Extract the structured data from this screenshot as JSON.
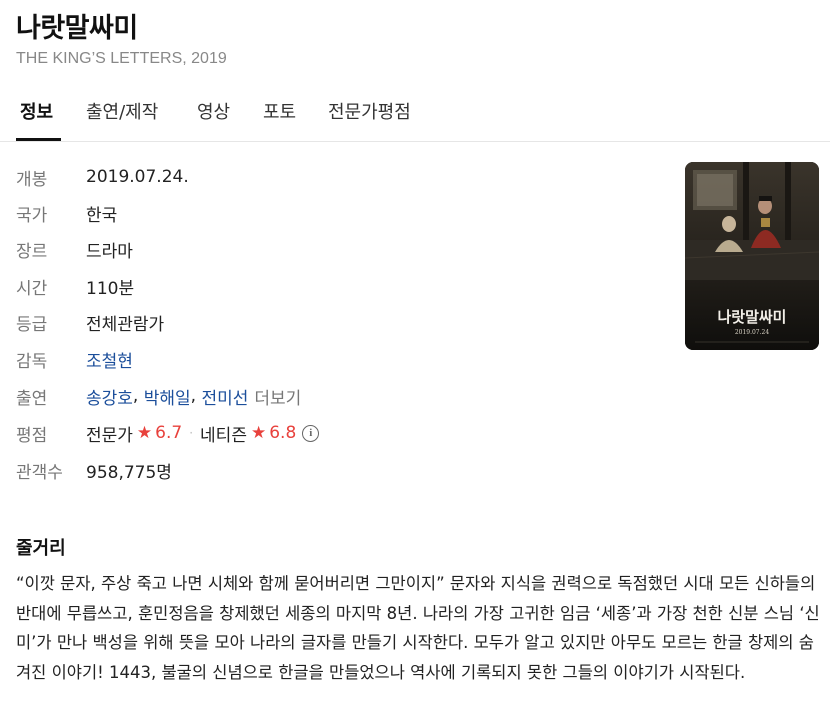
{
  "movie": {
    "title": "나랏말싸미",
    "subtitle": "THE KING’S LETTERS, 2019"
  },
  "tabs": [
    {
      "label": "정보",
      "active": true
    },
    {
      "label": "출연/제작",
      "active": false
    },
    {
      "label": "영상",
      "active": false
    },
    {
      "label": "포토",
      "active": false
    },
    {
      "label": "전문가평점",
      "active": false
    }
  ],
  "info": {
    "release": {
      "label": "개봉",
      "value": "2019.07.24."
    },
    "country": {
      "label": "국가",
      "value": "한국"
    },
    "genre": {
      "label": "장르",
      "value": "드라마"
    },
    "runtime": {
      "label": "시간",
      "value": "110분"
    },
    "rating": {
      "label": "등급",
      "value": "전체관람가"
    },
    "director": {
      "label": "감독",
      "value": "조철현"
    },
    "cast": {
      "label": "출연",
      "actors": [
        "송강호",
        "박해일",
        "전미선"
      ],
      "separator": ",",
      "more": "더보기"
    },
    "score": {
      "label": "평점",
      "critic_label": "전문가",
      "critic_score": "6.7",
      "netizen_label": "네티즌",
      "netizen_score": "6.8",
      "star_icon": "★",
      "dot": "·",
      "info_icon": "i"
    },
    "audience": {
      "label": "관객수",
      "value": "958,775명"
    }
  },
  "poster": {
    "title_text": "나랏말싸미",
    "date_text": "2019.07.24"
  },
  "synopsis": {
    "title": "줄거리",
    "text": "“이깟 문자, 주상 죽고 나면 시체와 함께 묻어버리면 그만이지” 문자와 지식을 권력으로 독점했던 시대 모든 신하들의 반대에 무릅쓰고, 훈민정음을 창제했던 세종의 마지막 8년. 나라의 가장 고귀한 임금 ‘세종’과 가장 천한 신분 스님 ‘신미’가 만나 백성을 위해 뜻을 모아 나라의 글자를 만들기 시작한다. 모두가 알고 있지만 아무도 모르는 한글 창제의 숨겨진 이야기! 1443, 불굴의 신념으로 한글을 만들었으나 역사에 기록되지 못한 그들의 이야기가 시작된다."
  },
  "colors": {
    "link": "#1b4e9b",
    "score": "#e8413c",
    "label": "#777777"
  }
}
